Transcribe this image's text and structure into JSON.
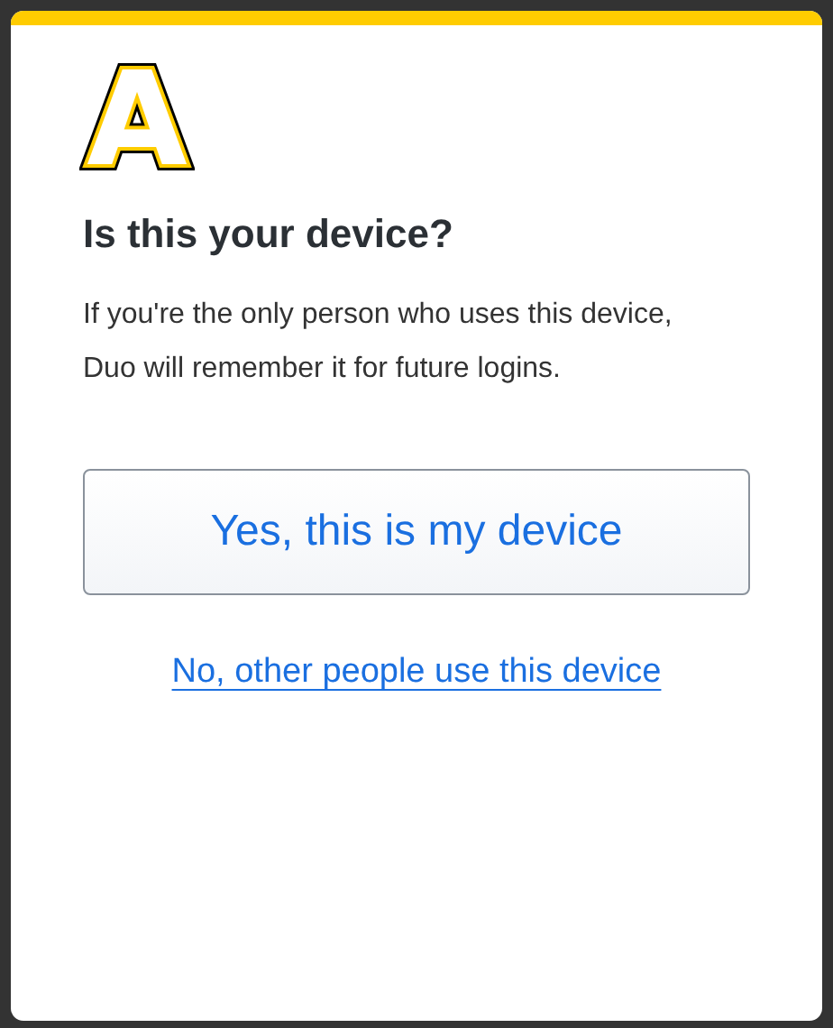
{
  "logo": {
    "letter": "A"
  },
  "heading": "Is this your device?",
  "description": "If you're the only person who uses this device, Duo will remember it for future logins.",
  "primary_button": "Yes, this is my device",
  "secondary_link": "No, other people use this device"
}
